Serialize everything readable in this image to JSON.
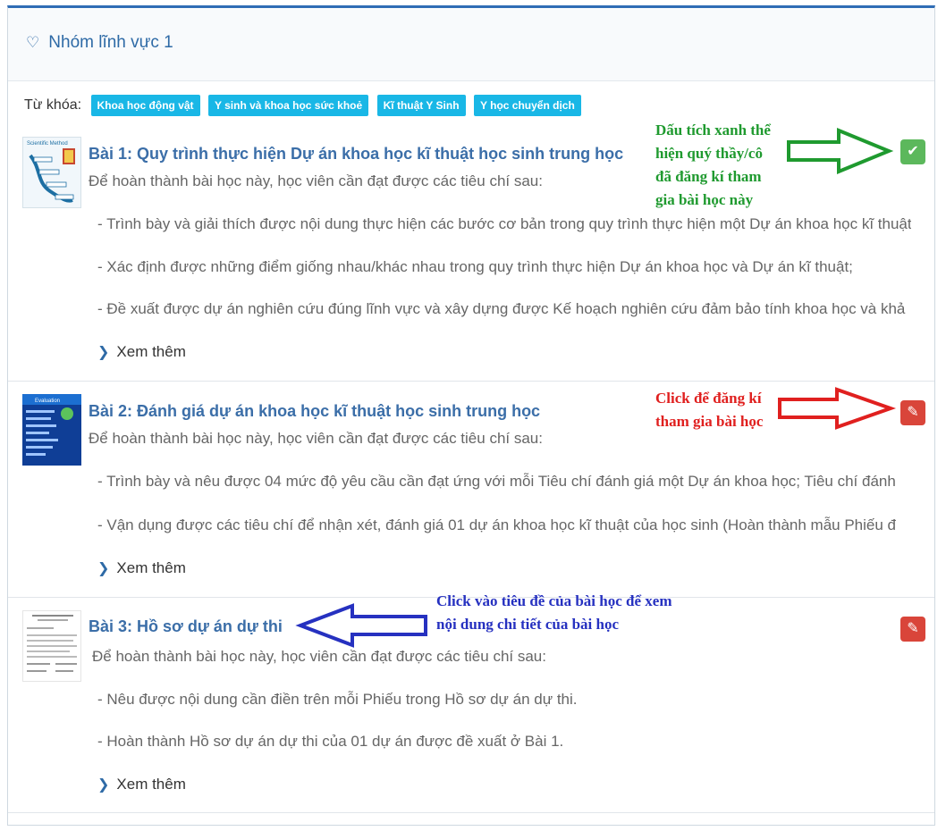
{
  "panel": {
    "title": "Nhóm lĩnh vực 1"
  },
  "keywords": {
    "label": "Từ khóa:",
    "tags": [
      "Khoa học động vật",
      "Y sinh và khoa học sức khoẻ",
      "Kĩ thuật Y Sinh",
      "Y học chuyển dịch"
    ]
  },
  "lessons": [
    {
      "title": "Bài 1: Quy trình thực hiện Dự án khoa học kĩ thuật học sinh trung học",
      "intro": "Để hoàn thành bài học này, học viên cần đạt được các tiêu chí sau:",
      "criteria": [
        "- Trình bày và giải thích được nội dung thực hiện các bước cơ bản trong quy trình thực hiện một Dự án khoa học kĩ thuật",
        "- Xác định được những điểm giống nhau/khác nhau trong quy trình thực hiện Dự án khoa học và Dự án kĩ thuật;",
        "- Đề xuất được dự án nghiên cứu đúng lĩnh vực và xây dựng được Kế hoạch nghiên cứu đảm bảo tính khoa học và khả"
      ],
      "more": "Xem thêm",
      "status": "registered"
    },
    {
      "title": "Bài 2: Đánh giá dự án khoa học kĩ thuật học sinh trung học",
      "intro": "Để hoàn thành bài học này, học viên cần đạt được các tiêu chí sau:",
      "criteria": [
        "- Trình bày và nêu được 04 mức độ yêu cầu cần đạt ứng với mỗi Tiêu chí đánh giá một Dự án khoa học; Tiêu chí đánh",
        "- Vận dụng được các tiêu chí để nhận xét, đánh giá 01 dự án khoa học kĩ thuật của học sinh (Hoàn thành mẫu Phiếu đ"
      ],
      "more": "Xem thêm",
      "status": "not-registered"
    },
    {
      "title": "Bài 3: Hồ sơ dự án dự thi",
      "intro": "Để hoàn thành bài học này, học viên cần đạt được các tiêu chí sau:",
      "criteria": [
        "- Nêu được nội dung cần điền trên mỗi Phiếu trong Hồ sơ dự án dự thi.",
        "- Hoàn thành Hồ sơ dự án dự thi của 01 dự án được đề xuất ở Bài 1."
      ],
      "more": "Xem thêm",
      "status": "not-registered"
    }
  ],
  "annotations": {
    "green": [
      "Dấu tích xanh thể",
      "hiện quý thầy/cô",
      "đã đăng kí tham",
      "gia bài học này"
    ],
    "red": [
      "Click để đăng kí",
      "tham gia bài học"
    ],
    "blue": [
      "Click vào tiêu đề của bài học để xem",
      "nội dung chi tiết của bài học"
    ]
  },
  "colors": {
    "accent": "#2e6aa6",
    "tag": "#19b7e6",
    "registered": "#5cb85c",
    "register": "#d9453a",
    "note_green": "#1f9a2f",
    "note_red": "#e0201f",
    "note_blue": "#2631c0"
  },
  "icons": {
    "panel": "hand-icon",
    "registered": "check-icon",
    "register": "pencil-icon",
    "more": "chevron-right-icon"
  }
}
